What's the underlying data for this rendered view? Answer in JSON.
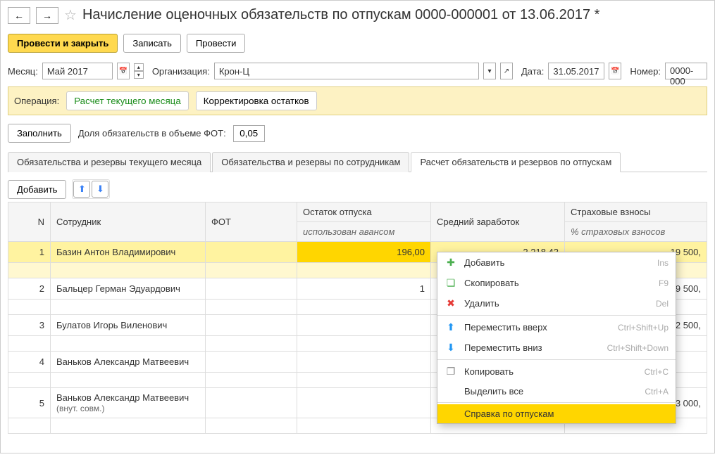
{
  "header": {
    "title": "Начисление оценочных обязательств по отпускам 0000-000001 от 13.06.2017 *"
  },
  "toolbar": {
    "post_close": "Провести и закрыть",
    "save": "Записать",
    "post": "Провести"
  },
  "fields": {
    "month_label": "Месяц:",
    "month_value": "Май 2017",
    "org_label": "Организация:",
    "org_value": "Крон-Ц",
    "date_label": "Дата:",
    "date_value": "31.05.2017",
    "number_label": "Номер:",
    "number_value": "0000-000"
  },
  "operation": {
    "label": "Операция:",
    "calc": "Расчет текущего месяца",
    "adjust": "Корректировка остатков"
  },
  "fill": {
    "btn": "Заполнить",
    "share_label": "Доля обязательств в объеме ФОТ:",
    "share_value": "0,05"
  },
  "tabs": {
    "t1": "Обязательства и резервы текущего месяца",
    "t2": "Обязательства и резервы по сотрудникам",
    "t3": "Расчет обязательств и резервов по отпускам"
  },
  "table_toolbar": {
    "add": "Добавить"
  },
  "columns": {
    "n": "N",
    "emp": "Сотрудник",
    "fot": "ФОТ",
    "ost": "Остаток отпуска",
    "ost_sub": "использован авансом",
    "avg": "Средний заработок",
    "ins": "Страховые взносы",
    "ins_sub": "% страховых взносов"
  },
  "rows": [
    {
      "n": "1",
      "emp": "Базин Антон Владимирович",
      "note": "",
      "ost": "196,00",
      "avg": "2 218,43",
      "ins": "19 500,"
    },
    {
      "n": "2",
      "emp": "Бальцер Герман Эдуардович",
      "note": "",
      "ost": "1",
      "avg": "",
      "ins": "19 500,"
    },
    {
      "n": "3",
      "emp": "Булатов Игорь Виленович",
      "note": "",
      "ost": "",
      "avg": "",
      "ins": "22 500,"
    },
    {
      "n": "4",
      "emp": "Ваньков Александр Матвеевич",
      "note": "",
      "ost": "",
      "avg": "",
      "ins": ""
    },
    {
      "n": "5",
      "emp": "Ваньков Александр Матвеевич",
      "note": "(внут. совм.)",
      "ost": "",
      "avg": "",
      "ins": "3 000,"
    }
  ],
  "menu": {
    "add": "Добавить",
    "add_sc": "Ins",
    "copy": "Скопировать",
    "copy_sc": "F9",
    "del": "Удалить",
    "del_sc": "Del",
    "up": "Переместить вверх",
    "up_sc": "Ctrl+Shift+Up",
    "down": "Переместить вниз",
    "down_sc": "Ctrl+Shift+Down",
    "clip": "Копировать",
    "clip_sc": "Ctrl+C",
    "selall": "Выделить все",
    "selall_sc": "Ctrl+A",
    "ref": "Справка по отпускам"
  }
}
